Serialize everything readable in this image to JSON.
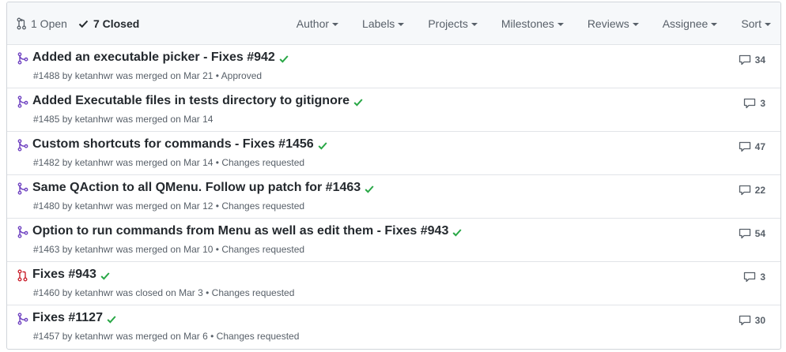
{
  "header": {
    "open_label": "1 Open",
    "closed_label": "7 Closed",
    "filters": [
      "Author",
      "Labels",
      "Projects",
      "Milestones",
      "Reviews",
      "Assignee",
      "Sort"
    ]
  },
  "pulls": [
    {
      "title": "Added an executable picker - Fixes #942",
      "meta": "#1488 by ketanhwr was merged on Mar 21 • Approved",
      "comments": "34",
      "state": "merged"
    },
    {
      "title": "Added Executable files in tests directory to gitignore",
      "meta": "#1485 by ketanhwr was merged on Mar 14",
      "comments": "3",
      "state": "merged"
    },
    {
      "title": "Custom shortcuts for commands - Fixes #1456",
      "meta": "#1482 by ketanhwr was merged on Mar 14 • Changes requested",
      "comments": "47",
      "state": "merged"
    },
    {
      "title": "Same QAction to all QMenu. Follow up patch for #1463",
      "meta": "#1480 by ketanhwr was merged on Mar 12 • Changes requested",
      "comments": "22",
      "state": "merged"
    },
    {
      "title": "Option to run commands from Menu as well as edit them - Fixes #943",
      "meta": "#1463 by ketanhwr was merged on Mar 10 • Changes requested",
      "comments": "54",
      "state": "merged"
    },
    {
      "title": "Fixes #943",
      "meta": "#1460 by ketanhwr was closed on Mar 3 • Changes requested",
      "comments": "3",
      "state": "closed"
    },
    {
      "title": "Fixes #1127",
      "meta": "#1457 by ketanhwr was merged on Mar 6 • Changes requested",
      "comments": "30",
      "state": "merged"
    }
  ],
  "colors": {
    "merged": "#6f42c1",
    "closed": "#cb2431",
    "check": "#28a745"
  }
}
